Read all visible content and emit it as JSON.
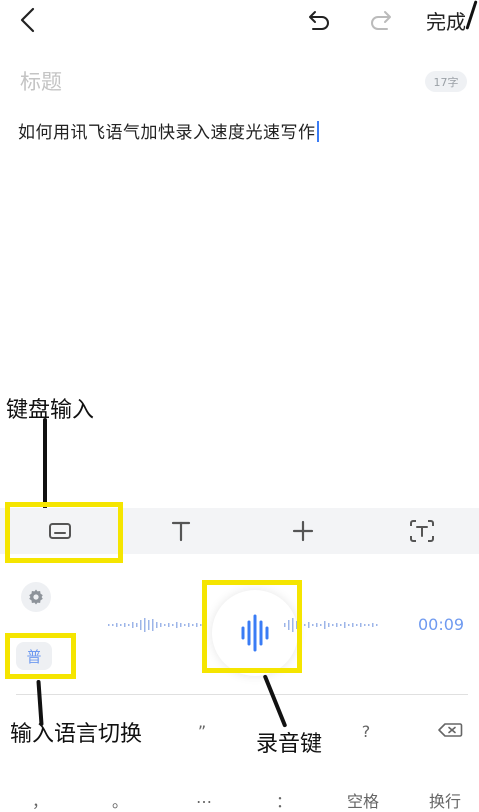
{
  "header": {
    "back_icon": "chevron-left-icon",
    "undo_icon": "undo-icon",
    "redo_icon": "redo-icon",
    "done_label": "完成"
  },
  "editor": {
    "title_placeholder": "标题",
    "char_count": "17字",
    "body_text": "如何用讯飞语气加快录入速度光速写作"
  },
  "annotations": {
    "keyboard_input": "键盘输入",
    "language_switch": "输入语言切换",
    "record_key": "录音键"
  },
  "toolbar": {
    "items": [
      {
        "icon": "keyboard-icon"
      },
      {
        "icon": "text-format-icon"
      },
      {
        "icon": "plus-icon"
      },
      {
        "icon": "ocr-text-icon"
      }
    ]
  },
  "voice": {
    "settings_icon": "gear-icon",
    "lang_label": "普",
    "timer": "00:09"
  },
  "keyboard": {
    "row1": [
      "”",
      "?"
    ],
    "row2": [
      "，",
      "。",
      "…",
      "：",
      "空格",
      "换行"
    ],
    "backspace_icon": "backspace-icon"
  },
  "colors": {
    "accent": "#3a7cf5",
    "voice_blue": "#6f9af0",
    "highlight_yellow": "#f5e500"
  }
}
